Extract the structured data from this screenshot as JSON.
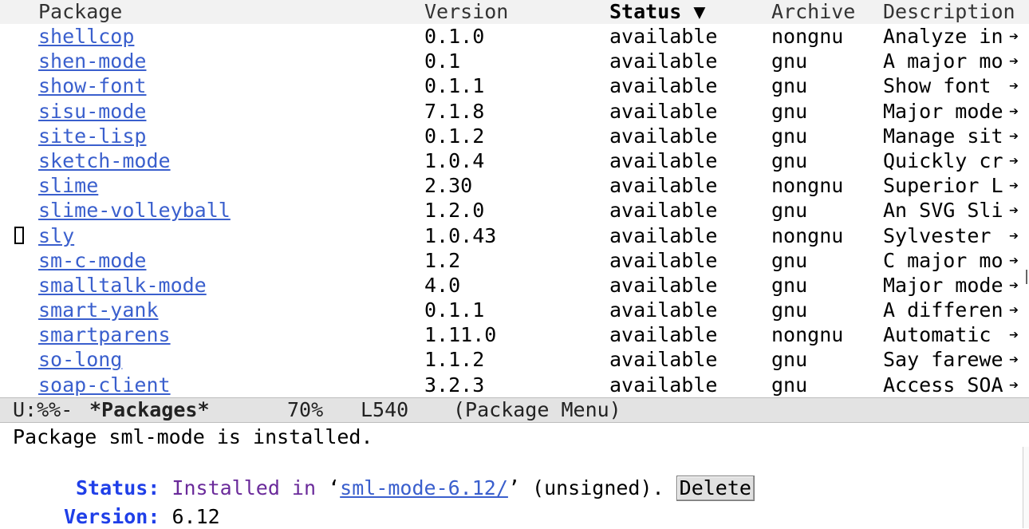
{
  "header": {
    "package": "Package",
    "version": "Version",
    "status": "Status ▼",
    "archive": "Archive",
    "description": "Description"
  },
  "packages": [
    {
      "name": "shellcop",
      "version": "0.1.0",
      "status": "available",
      "archive": "nongnu",
      "description": "Analyze in"
    },
    {
      "name": "shen-mode",
      "version": "0.1",
      "status": "available",
      "archive": "gnu",
      "description": "A major mo"
    },
    {
      "name": "show-font",
      "version": "0.1.1",
      "status": "available",
      "archive": "gnu",
      "description": "Show font "
    },
    {
      "name": "sisu-mode",
      "version": "7.1.8",
      "status": "available",
      "archive": "gnu",
      "description": "Major mode"
    },
    {
      "name": "site-lisp",
      "version": "0.1.2",
      "status": "available",
      "archive": "gnu",
      "description": "Manage sit"
    },
    {
      "name": "sketch-mode",
      "version": "1.0.4",
      "status": "available",
      "archive": "gnu",
      "description": "Quickly cr"
    },
    {
      "name": "slime",
      "version": "2.30",
      "status": "available",
      "archive": "nongnu",
      "description": "Superior L"
    },
    {
      "name": "slime-volleyball",
      "version": "1.2.0",
      "status": "available",
      "archive": "gnu",
      "description": "An SVG Sli"
    },
    {
      "name": "sly",
      "version": "1.0.43",
      "status": "available",
      "archive": "nongnu",
      "description": "Sylvester "
    },
    {
      "name": "sm-c-mode",
      "version": "1.2",
      "status": "available",
      "archive": "gnu",
      "description": "C major mo"
    },
    {
      "name": "smalltalk-mode",
      "version": "4.0",
      "status": "available",
      "archive": "gnu",
      "description": "Major mode"
    },
    {
      "name": "smart-yank",
      "version": "0.1.1",
      "status": "available",
      "archive": "gnu",
      "description": "A differen"
    },
    {
      "name": "smartparens",
      "version": "1.11.0",
      "status": "available",
      "archive": "nongnu",
      "description": "Automatic "
    },
    {
      "name": "so-long",
      "version": "1.1.2",
      "status": "available",
      "archive": "gnu",
      "description": "Say farewe"
    },
    {
      "name": "soap-client",
      "version": "3.2.3",
      "status": "available",
      "archive": "gnu",
      "description": "Access SOA"
    }
  ],
  "truncation_glyph": "➔",
  "cursor_row": 8,
  "mode_line": {
    "state": "U:%%-",
    "buffer": "*Packages*",
    "percent": "70%",
    "line": "L540",
    "mode": "(Package Menu)"
  },
  "echo": "Package sml-mode is installed.",
  "details": {
    "status_label": "Status:",
    "installed_text": "Installed in",
    "quote_open": "‘",
    "dir_link": "sml-mode-6.12/",
    "quote_close": "’",
    "unsigned_text": "(unsigned).",
    "delete_button": "Delete",
    "version_label": "Version:",
    "version_value": "6.12"
  },
  "colors": {
    "link": "#3a5fcd",
    "label": "#1f3fe8",
    "installed": "#6a2a9a",
    "header_bg": "#f2f2f2",
    "modeline_bg": "#e3e3e3"
  }
}
